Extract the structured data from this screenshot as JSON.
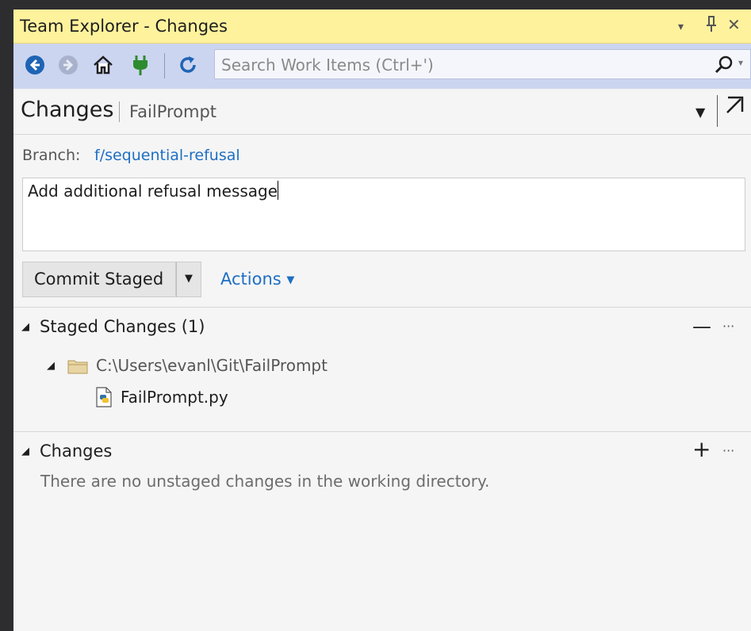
{
  "window": {
    "title": "Team Explorer - Changes",
    "controls": {
      "dropdown": "▾",
      "pin": "⊥",
      "close": "✕"
    }
  },
  "toolbar": {
    "search_placeholder": "Search Work Items (Ctrl+')",
    "icons": [
      "back-icon",
      "forward-icon",
      "home-icon",
      "connect-icon",
      "refresh-icon",
      "search-icon"
    ]
  },
  "header": {
    "title": "Changes",
    "separator": "|",
    "repo": "FailPrompt"
  },
  "branch": {
    "label": "Branch:",
    "name": "f/sequential-refusal"
  },
  "commit": {
    "message": "Add additional refusal message",
    "button_label": "Commit Staged",
    "actions_label": "Actions"
  },
  "staged": {
    "title": "Staged Changes (1)",
    "folder": "C:\\Users\\evanl\\Git\\FailPrompt",
    "files": [
      "FailPrompt.py"
    ]
  },
  "changes": {
    "title": "Changes",
    "empty_message": "There are no unstaged changes in the working directory."
  },
  "colors": {
    "title_bar": "#fff29d",
    "toolbar": "#ccd5f0",
    "link": "#1e6fc4",
    "panel_bg": "#f5f5f5"
  }
}
